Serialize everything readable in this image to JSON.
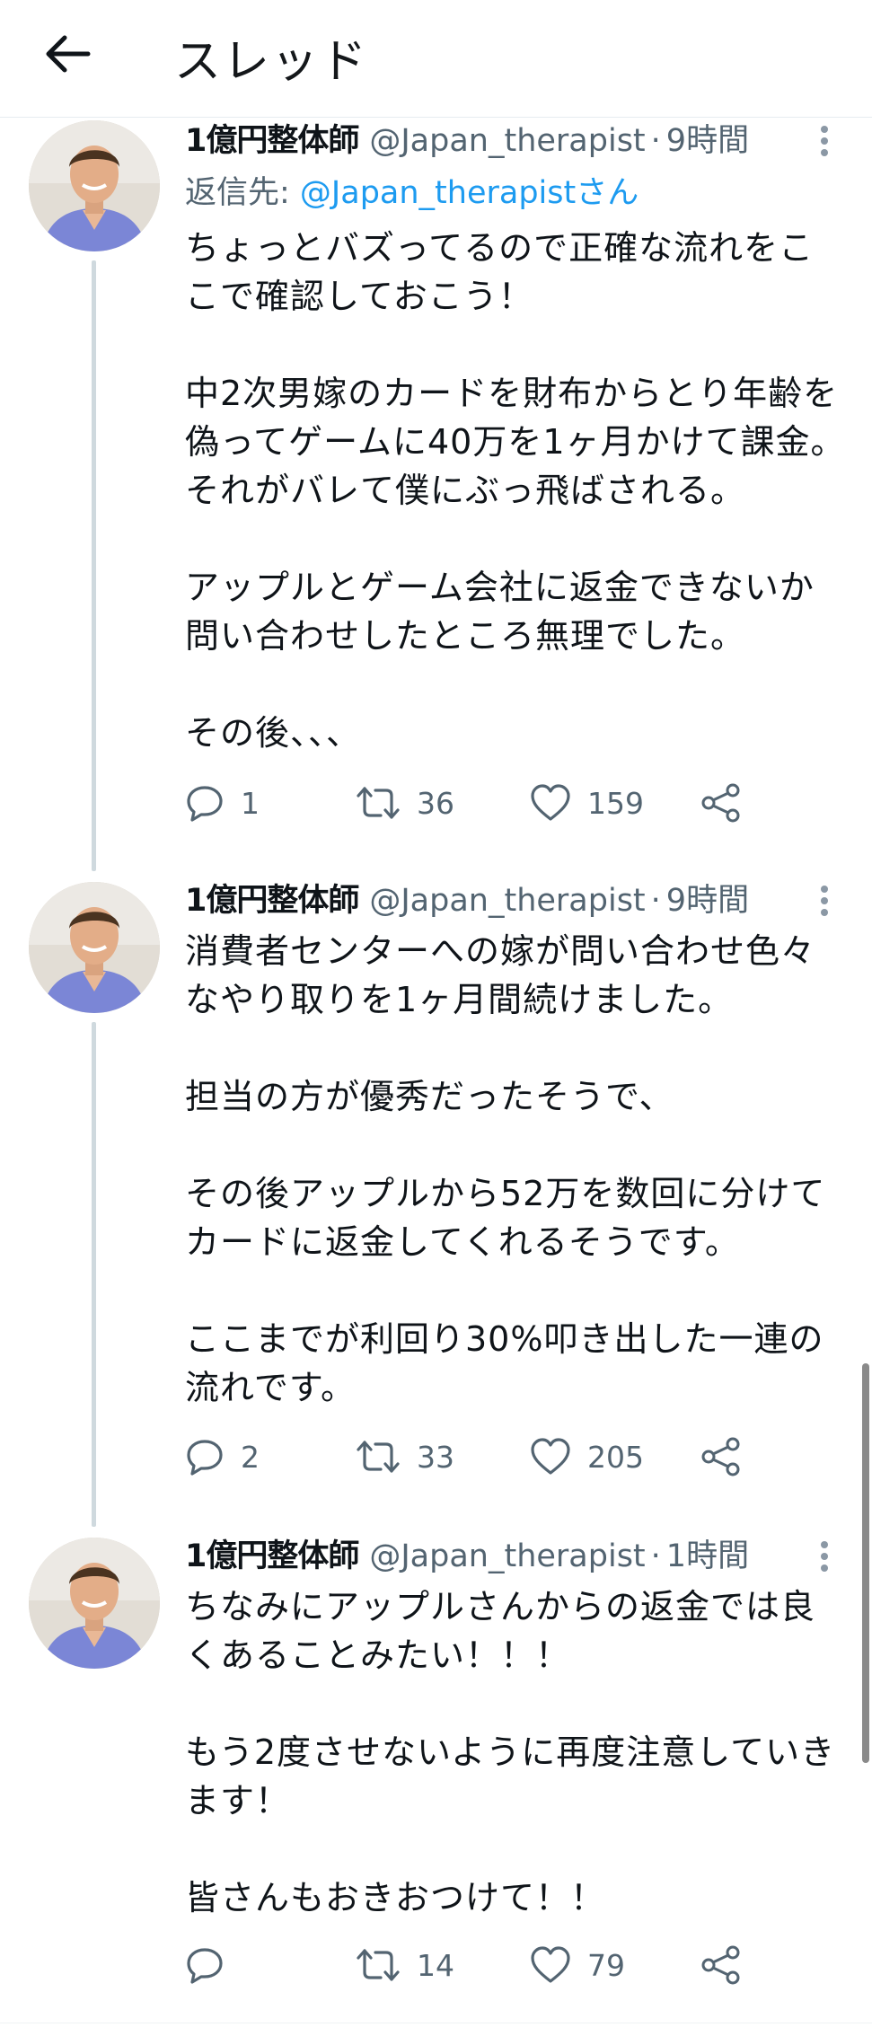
{
  "header": {
    "title": "スレッド",
    "back_icon": "arrow-left-icon"
  },
  "colors": {
    "link": "#1d9bf0",
    "secondary": "#536471",
    "text": "#0f1419",
    "thread_line": "#cfd9de"
  },
  "tweets": [
    {
      "name": "1億円整体師",
      "handle": "@Japan_therapist",
      "separator": "·",
      "time": "9時間",
      "reply_prefix": "返信先: ",
      "reply_to": "@Japan_therapistさん",
      "lines": [
        "ちょっとバズってるので正確な流れをこ",
        "こで確認しておこう！",
        "",
        "中2次男嫁のカードを財布からとり年齢を",
        "偽ってゲームに40万を1ヶ月かけて課金。",
        "それがバレて僕にぶっ飛ばされる。",
        "",
        "アップルとゲーム会社に返金できないか",
        "問い合わせしたところ無理でした。",
        "",
        "その後、、、"
      ],
      "replies": "1",
      "retweets": "36",
      "likes": "159"
    },
    {
      "name": "1億円整体師",
      "handle": "@Japan_therapist",
      "separator": "·",
      "time": "9時間",
      "lines": [
        "消費者センターへの嫁が問い合わせ色々",
        "なやり取りを1ヶ月間続けました。",
        "",
        "担当の方が優秀だったそうで、",
        "",
        "その後アップルから52万を数回に分けて",
        "カードに返金してくれるそうです。",
        "",
        "ここまでが利回り30%叩き出した一連の",
        "流れです。"
      ],
      "replies": "2",
      "retweets": "33",
      "likes": "205"
    },
    {
      "name": "1億円整体師",
      "handle": "@Japan_therapist",
      "separator": "·",
      "time": "1時間",
      "lines": [
        "ちなみにアップルさんからの返金では良",
        "くあることみたい！！！",
        "",
        "もう2度させないように再度注意していき",
        "ます！",
        "",
        "皆さんもおきおつけて！！"
      ],
      "replies": "",
      "retweets": "14",
      "likes": "79"
    }
  ]
}
